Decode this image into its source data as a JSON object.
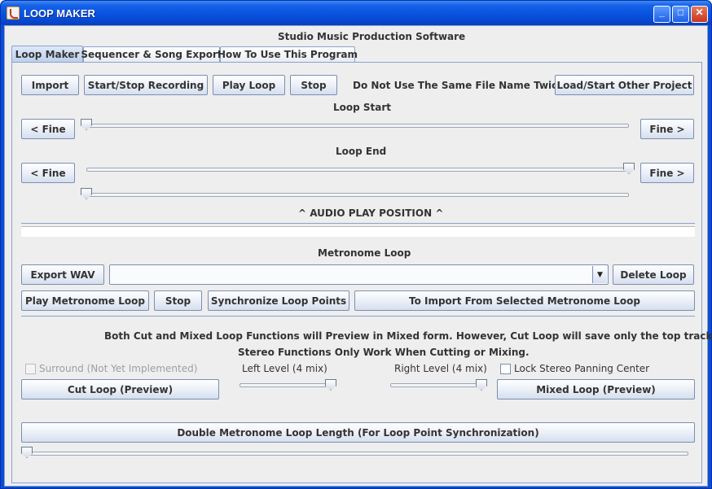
{
  "window": {
    "title": "LOOP MAKER",
    "minimize": "_",
    "maximize": "□",
    "close": "✕"
  },
  "header": {
    "app_name": "Studio Music Production Software"
  },
  "tabs": [
    {
      "label": "Loop Maker",
      "active": true
    },
    {
      "label": "Sequencer & Song Export",
      "active": false
    },
    {
      "label": "How To Use This Program",
      "active": false
    }
  ],
  "toolbar": {
    "import": "Import",
    "record": "Start/Stop Recording",
    "play_loop": "Play Loop",
    "stop": "Stop",
    "warning": "Do Not Use The Same File Name Twice.",
    "load_project": "Load/Start Other Project"
  },
  "loop_start": {
    "label": "Loop Start",
    "fine_left": "< Fine",
    "fine_right": "Fine >",
    "position": 0.0
  },
  "loop_end": {
    "label": "Loop End",
    "fine_left": "< Fine",
    "fine_right": "Fine >",
    "position": 1.0
  },
  "play_position": {
    "label": "^ AUDIO PLAY POSITION ^",
    "position": 0.0
  },
  "metronome": {
    "label": "Metronome Loop",
    "export_wav": "Export WAV",
    "selected": "",
    "delete_loop": "Delete Loop",
    "play": "Play Metronome Loop",
    "stop": "Stop",
    "sync": "Synchronize Loop Points",
    "import_selected": "To Import From Selected Metronome Loop"
  },
  "mix": {
    "note1": "Both Cut and Mixed Loop Functions will Preview in Mixed form.  However, Cut Loop will save only the top track.",
    "note2": "Stereo Functions Only Work When Cutting or Mixing.",
    "surround": "Surround (Not Yet Implemented)",
    "left_level": "Left Level (4 mix)",
    "right_level": "Right Level (4 mix)",
    "lock_stereo": "Lock Stereo Panning Center",
    "cut_loop": "Cut Loop (Preview)",
    "mixed_loop": "Mixed Loop (Preview)",
    "left_level_value": 1.0,
    "right_level_value": 1.0
  },
  "double_loop": {
    "label": "Double Metronome Loop Length (For Loop Point Synchronization)",
    "position": 0.0
  }
}
